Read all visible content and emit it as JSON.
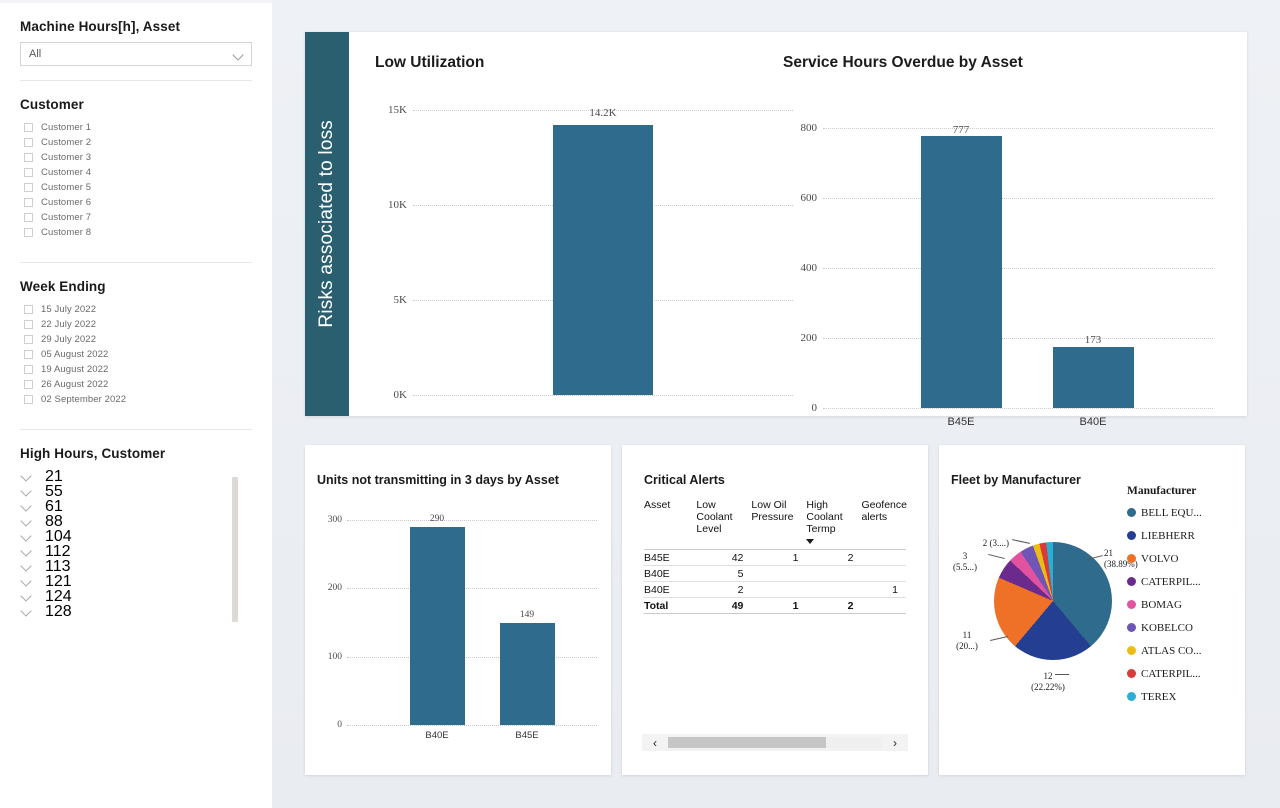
{
  "filters": {
    "machine_hours": {
      "title": "Machine Hours[h], Asset",
      "dropdown_value": "All",
      "dropdown_placeholder": "All"
    },
    "customer": {
      "title": "Customer",
      "items": [
        {
          "label": "Customer 1",
          "checked": false
        },
        {
          "label": "Customer 2",
          "checked": false
        },
        {
          "label": "Customer 3",
          "checked": false
        },
        {
          "label": "Customer 4",
          "checked": false
        },
        {
          "label": "Customer 5",
          "checked": false
        },
        {
          "label": "Customer 6",
          "checked": false
        },
        {
          "label": "Customer 7",
          "checked": false
        },
        {
          "label": "Customer 8",
          "checked": false
        }
      ]
    },
    "week_ending": {
      "title": "Week Ending",
      "items": [
        {
          "label": "15 July 2022",
          "checked": false
        },
        {
          "label": "22 July 2022",
          "checked": false
        },
        {
          "label": "29 July 2022",
          "checked": false
        },
        {
          "label": "05 August 2022",
          "checked": false
        },
        {
          "label": "19 August 2022",
          "checked": false
        },
        {
          "label": "26 August 2022",
          "checked": false
        },
        {
          "label": "02 September 2022",
          "checked": false
        }
      ]
    },
    "high_hours": {
      "title": "High Hours, Customer",
      "items": [
        {
          "label": "21",
          "checked": false
        },
        {
          "label": "55",
          "checked": false
        },
        {
          "label": "61",
          "checked": false
        },
        {
          "label": "88",
          "checked": false
        },
        {
          "label": "104",
          "checked": false
        },
        {
          "label": "112",
          "checked": false
        },
        {
          "label": "113",
          "checked": false
        },
        {
          "label": "121",
          "checked": false
        },
        {
          "label": "124",
          "checked": false
        },
        {
          "label": "128",
          "checked": false
        }
      ]
    }
  },
  "banner": {
    "label": "Risks associated to loss"
  },
  "colors": {
    "bar": "#2e6b8c",
    "banner": "#2a5f70",
    "background": "#e9ecf1"
  },
  "alerts": {
    "title": "Critical Alerts",
    "columns": [
      "Asset",
      "Low Coolant Level",
      "Low Oil Pressure",
      "High Coolant Termp",
      "Geofence alerts"
    ],
    "sorted_column": "High Coolant Termp",
    "sort_direction": "desc",
    "rows": [
      {
        "asset": "B45E",
        "low_coolant_level": "42",
        "low_oil_pressure": "1",
        "high_coolant_termp": "2",
        "geofence_alerts": ""
      },
      {
        "asset": "B40E",
        "low_coolant_level": "5",
        "low_oil_pressure": "",
        "high_coolant_termp": "",
        "geofence_alerts": ""
      },
      {
        "asset": "B40E",
        "low_coolant_level": "2",
        "low_oil_pressure": "",
        "high_coolant_termp": "",
        "geofence_alerts": "1"
      }
    ],
    "total": {
      "asset": "Total",
      "low_coolant_level": "49",
      "low_oil_pressure": "1",
      "high_coolant_termp": "2",
      "geofence_alerts": ""
    },
    "scroll_left_icon": "‹",
    "scroll_right_icon": "›"
  },
  "chart_data": [
    {
      "type": "bar",
      "title": "Low Utilization",
      "categories": [
        ""
      ],
      "values": [
        14200
      ],
      "value_labels": [
        "14.2K"
      ],
      "ylabel": "",
      "xlabel": "",
      "ytick_labels": [
        "0K",
        "5K",
        "10K",
        "15K"
      ],
      "ytick_values": [
        0,
        5000,
        10000,
        15000
      ],
      "ylim": [
        0,
        15800
      ],
      "grid": true,
      "legend": "none"
    },
    {
      "type": "bar",
      "title": "Service Hours Overdue by Asset",
      "categories": [
        "B45E",
        "B40E"
      ],
      "values": [
        777,
        173
      ],
      "value_labels": [
        "777",
        "173"
      ],
      "ylabel": "",
      "xlabel": "",
      "ytick_labels": [
        "0",
        "200",
        "400",
        "600",
        "800"
      ],
      "ytick_values": [
        0,
        200,
        400,
        600,
        800
      ],
      "ylim": [
        0,
        825
      ],
      "grid": true,
      "legend": "none"
    },
    {
      "type": "bar",
      "title": "Units not transmitting in 3 days by Asset",
      "categories": [
        "B40E",
        "B45E"
      ],
      "values": [
        290,
        149
      ],
      "value_labels": [
        "290",
        "149"
      ],
      "ylabel": "",
      "xlabel": "",
      "ytick_labels": [
        "0",
        "100",
        "200",
        "300"
      ],
      "ytick_values": [
        0,
        100,
        200,
        300
      ],
      "ylim": [
        0,
        312
      ],
      "grid": true,
      "legend": "none"
    },
    {
      "type": "pie",
      "title": "Fleet by Manufacturer",
      "legend_title": "Manufacturer",
      "legend_position": "right",
      "labels": [
        "BELL EQU...",
        "LIEBHERR",
        "VOLVO",
        "CATERPIL...",
        "BOMAG",
        "KOBELCO",
        "ATLAS CO...",
        "CATERPIL...",
        "TEREX"
      ],
      "values": [
        21,
        12,
        11,
        3,
        2,
        2,
        1,
        1,
        1
      ],
      "colors": [
        "#2e6b8c",
        "#243e91",
        "#ef7128",
        "#6c2b8c",
        "#e2539f",
        "#6f55b5",
        "#ecbc12",
        "#d93a3a",
        "#29aed4"
      ],
      "callouts": [
        {
          "text_line1": "21",
          "text_line2": "(38.89%)"
        },
        {
          "text_line1": "12",
          "text_line2": "(22.22%)"
        },
        {
          "text_line1": "11",
          "text_line2": "(20...)"
        },
        {
          "text_line1": "3",
          "text_line2": "(5.5...)"
        },
        {
          "text_line1": "2 (3....)",
          "text_line2": ""
        }
      ]
    }
  ]
}
